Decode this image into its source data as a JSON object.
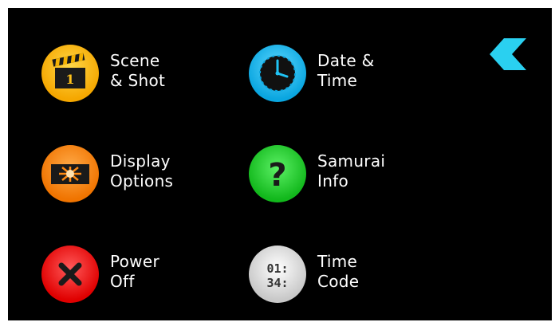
{
  "colors": {
    "background": "#000000",
    "scene": "#ffc21a",
    "datetime": "#1fc3f5",
    "display": "#ff8a12",
    "info": "#23d92e",
    "power": "#ff1a1a",
    "timecode": "#e9e9e9",
    "back": "#2ad0f0"
  },
  "menu": {
    "scene_shot": {
      "line1": "Scene",
      "line2": "& Shot",
      "icon": "clapperboard-icon",
      "clapper_number": "1"
    },
    "date_time": {
      "line1": "Date &",
      "line2": "Time",
      "icon": "clock-icon"
    },
    "display_options": {
      "line1": "Display",
      "line2": "Options",
      "icon": "display-options-icon"
    },
    "samurai_info": {
      "line1": "Samurai",
      "line2": "Info",
      "icon": "question-mark-icon",
      "glyph": "?"
    },
    "power_off": {
      "line1": "Power",
      "line2": "Off",
      "icon": "close-x-icon"
    },
    "time_code": {
      "line1": "Time",
      "line2": "Code",
      "icon": "timecode-icon",
      "digits_top": "01:",
      "digits_bottom": "34:"
    }
  },
  "back": {
    "icon": "back-chevron-icon"
  }
}
